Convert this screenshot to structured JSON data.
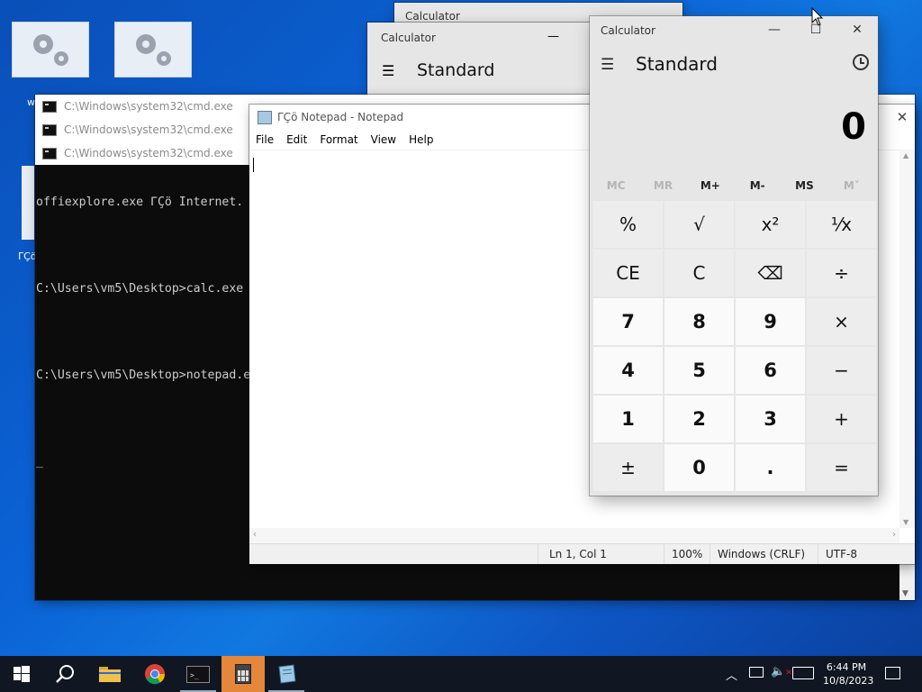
{
  "desktop": {
    "icons": [
      {
        "name": "settings-shortcut-1"
      },
      {
        "name": "settings-shortcut-2"
      }
    ],
    "partial_label": "w",
    "partial_label2": "ΓÇö"
  },
  "cmd_windows": {
    "titles": [
      "C:\\Windows\\system32\\cmd.exe",
      "C:\\Windows\\system32\\cmd.exe",
      "C:\\Windows\\system32\\cmd.exe"
    ],
    "lines": [
      "offiexplore.exe ΓÇö Internet.",
      "",
      "C:\\Users\\vm5\\Desktop>calc.exe",
      "",
      "C:\\Users\\vm5\\Desktop>notepad.e",
      "",
      "_"
    ]
  },
  "notepad": {
    "title": "ΓÇö Notepad - Notepad",
    "menu": [
      "File",
      "Edit",
      "Format",
      "View",
      "Help"
    ],
    "status": {
      "position": "Ln 1, Col 1",
      "zoom": "100%",
      "line_ending": "Windows (CRLF)",
      "encoding": "UTF-8"
    }
  },
  "calc_bg1": {
    "title": "Calculator"
  },
  "calc_bg2": {
    "title": "Calculator",
    "mode": "Standard"
  },
  "calculator": {
    "title": "Calculator",
    "mode": "Standard",
    "display": "0",
    "memory": [
      "MC",
      "MR",
      "M+",
      "M-",
      "MS",
      "M˅"
    ],
    "keys": [
      {
        "label": "%",
        "type": "op",
        "name": "percent-key"
      },
      {
        "label": "√",
        "type": "op",
        "name": "square-root-key"
      },
      {
        "label": "x²",
        "type": "op",
        "name": "square-key"
      },
      {
        "label": "¹⁄x",
        "type": "op",
        "name": "reciprocal-key"
      },
      {
        "label": "CE",
        "type": "op",
        "name": "clear-entry-key"
      },
      {
        "label": "C",
        "type": "op",
        "name": "clear-key"
      },
      {
        "label": "⌫",
        "type": "op",
        "name": "backspace-key"
      },
      {
        "label": "÷",
        "type": "op",
        "name": "divide-key"
      },
      {
        "label": "7",
        "type": "num",
        "name": "digit-7-key"
      },
      {
        "label": "8",
        "type": "num",
        "name": "digit-8-key"
      },
      {
        "label": "9",
        "type": "num",
        "name": "digit-9-key"
      },
      {
        "label": "×",
        "type": "op",
        "name": "multiply-key"
      },
      {
        "label": "4",
        "type": "num",
        "name": "digit-4-key"
      },
      {
        "label": "5",
        "type": "num",
        "name": "digit-5-key"
      },
      {
        "label": "6",
        "type": "num",
        "name": "digit-6-key"
      },
      {
        "label": "−",
        "type": "op",
        "name": "subtract-key"
      },
      {
        "label": "1",
        "type": "num",
        "name": "digit-1-key"
      },
      {
        "label": "2",
        "type": "num",
        "name": "digit-2-key"
      },
      {
        "label": "3",
        "type": "num",
        "name": "digit-3-key"
      },
      {
        "label": "+",
        "type": "op",
        "name": "add-key"
      },
      {
        "label": "±",
        "type": "op",
        "name": "negate-key"
      },
      {
        "label": "0",
        "type": "num",
        "name": "digit-0-key"
      },
      {
        "label": ".",
        "type": "num",
        "name": "decimal-key"
      },
      {
        "label": "=",
        "type": "op",
        "name": "equals-key"
      }
    ]
  },
  "taskbar": {
    "items": [
      "start-icon",
      "search-icon",
      "file-explorer-icon",
      "chrome-icon",
      "cmd-icon",
      "calculator-icon",
      "notepad-icon"
    ],
    "time": "6:44 PM",
    "date": "10/8/2023",
    "colors": {
      "active_app": "#e4873a",
      "taskbar": "#101722"
    }
  }
}
